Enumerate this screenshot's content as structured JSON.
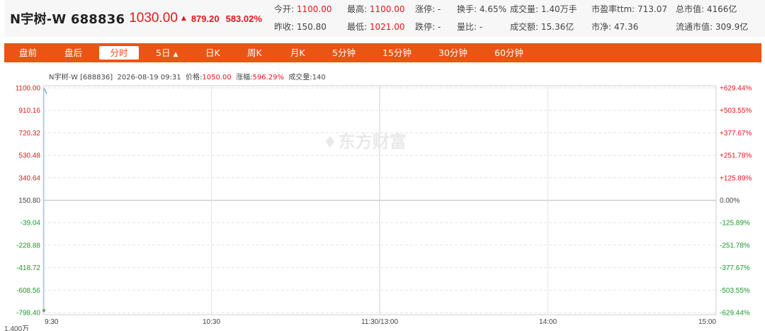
{
  "stock": {
    "name": "N宇树-W",
    "code": "688836",
    "price": "1030.00",
    "change": "879.20",
    "change_pct": "583.02%"
  },
  "quote": {
    "open_label": "今开:",
    "open": "1100.00",
    "high_label": "最高:",
    "high": "1100.00",
    "limit_up_label": "涨停:",
    "limit_up": "-",
    "turnover_label": "换手:",
    "turnover": "4.65%",
    "volume_label": "成交量:",
    "volume": "1.40万手",
    "pe_label": "市盈率ttm:",
    "pe": "713.07",
    "mcap_label": "总市值:",
    "mcap": "4166亿",
    "prev_close_label": "昨收:",
    "prev_close": "150.80",
    "low_label": "最低:",
    "low": "1021.00",
    "limit_down_label": "跌停:",
    "limit_down": "-",
    "vol_ratio_label": "量比:",
    "vol_ratio": "-",
    "amount_label": "成交额:",
    "amount": "15.36亿",
    "pb_label": "市净:",
    "pb": "47.36",
    "float_mcap_label": "流通市值:",
    "float_mcap": "309.9亿"
  },
  "toolbar": {
    "premarket": "盘前",
    "afterhours": "盘后",
    "intraday": "分时",
    "five_day": "5日",
    "five_day_arrow": "▲",
    "daily_k": "日K",
    "weekly_k": "周K",
    "monthly_k": "月K",
    "min5": "5分钟",
    "min15": "15分钟",
    "min30": "30分钟",
    "min60": "60分钟"
  },
  "chart_info": {
    "name": "N宇树-W [688836]",
    "datetime": "2026-08-19 09:31",
    "price_label": "价格:",
    "price": "1050.00",
    "pct_label": "涨幅:",
    "pct": "596.29%",
    "vol_label": "成交量:",
    "vol": "140"
  },
  "watermark": "东方财富",
  "chart_data": {
    "type": "line",
    "y_ticks_left": [
      "1100.00",
      "910.16",
      "720.32",
      "530.48",
      "340.64",
      "150.80",
      "-39.04",
      "-228.88",
      "-418.72",
      "-608.56",
      "-798.40"
    ],
    "y_ticks_right": [
      "+629.44%",
      "+503.55%",
      "+377.67%",
      "+251.78%",
      "+125.89%",
      "0.00%",
      "-125.89%",
      "-251.78%",
      "-377.67%",
      "-503.55%",
      "-629.44%"
    ],
    "x_ticks": [
      "9:30",
      "10:30",
      "11:30/13:00",
      "14:00",
      "15:00"
    ],
    "ylim": [
      -798.4,
      1100.0
    ],
    "prev_close": 150.8,
    "bottom_label": "1.400万",
    "series": [
      {
        "x": [
          "9:30",
          "9:31"
        ],
        "values": [
          1100.0,
          1050.0
        ]
      }
    ],
    "colors": {
      "up": "#e4161c",
      "down": "#1a9b2d",
      "line": "#3f86d9",
      "grid": "#e3e3e3"
    }
  }
}
